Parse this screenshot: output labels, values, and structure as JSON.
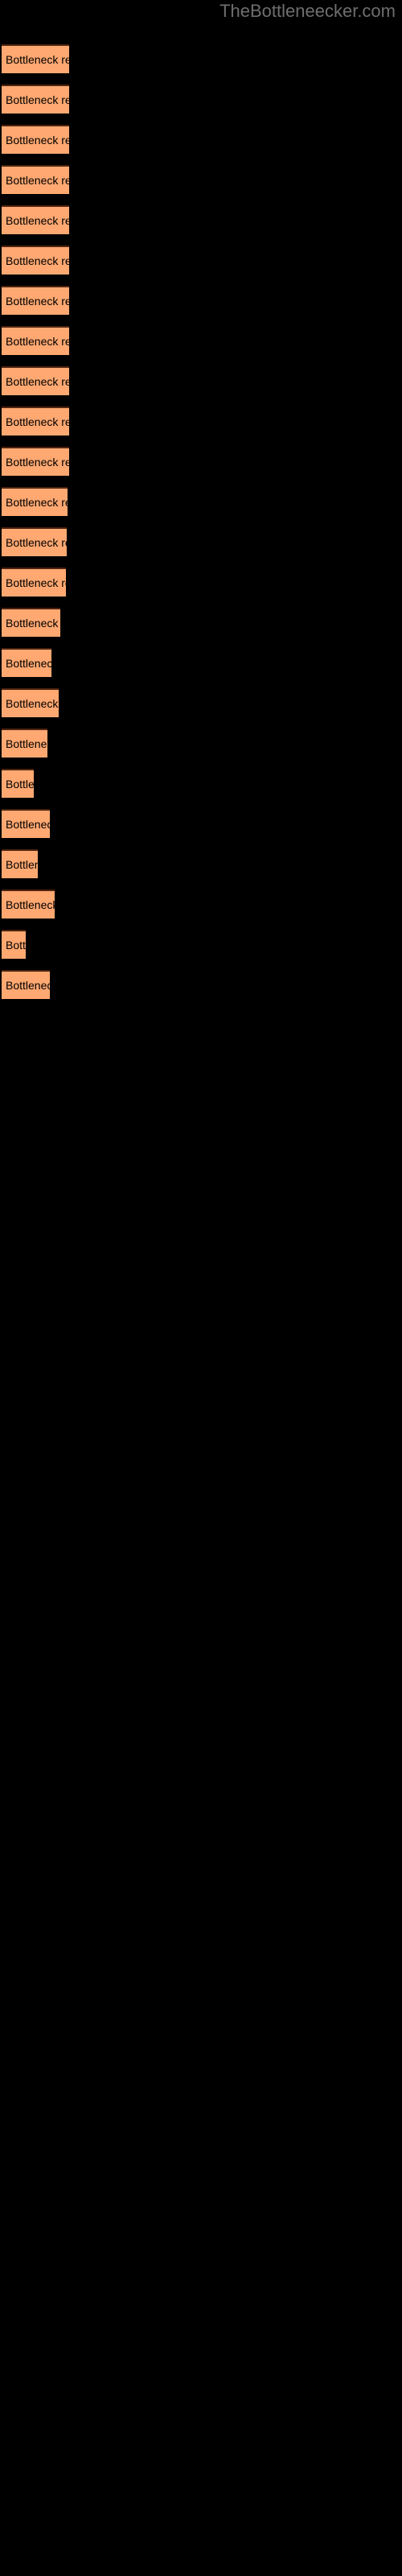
{
  "watermark": {
    "text": "TheBottleneecker.com"
  },
  "chart_data": {
    "type": "bar",
    "orientation": "horizontal",
    "title": "",
    "xlabel": "",
    "ylabel": "",
    "grid": false,
    "legend": null,
    "bar_color": "#ffa871",
    "bar_border_color": "#4d2310",
    "background_color": "#000000",
    "label_color": "#000000",
    "bar_label_text": "Bottleneck result",
    "categories": [
      "Bottleneck result",
      "Bottleneck result",
      "Bottleneck result",
      "Bottleneck result",
      "Bottleneck result",
      "Bottleneck result",
      "Bottleneck result",
      "Bottleneck result",
      "Bottleneck result",
      "Bottleneck result",
      "Bottleneck result",
      "Bottleneck result",
      "Bottleneck result",
      "Bottleneck result",
      "Bottleneck result",
      "Bottleneck result",
      "Bottleneck result",
      "Bottleneck result",
      "Bottleneck result",
      "Bottleneck result",
      "Bottleneck result",
      "Bottleneck result",
      "Bottleneck result",
      "Bottleneck result"
    ],
    "values": [
      84,
      84,
      84,
      84,
      84,
      84,
      84,
      84,
      84,
      84,
      84,
      82,
      81,
      80,
      73,
      62,
      71,
      57,
      40,
      60,
      45,
      66,
      30,
      60
    ],
    "bar_tops": [
      55,
      105,
      155,
      205,
      255,
      305,
      355,
      405,
      455,
      505,
      555,
      605,
      655,
      705,
      755,
      805,
      855,
      905,
      955,
      1005,
      1055,
      1105,
      1155,
      1205
    ],
    "xlim": [
      0,
      84
    ],
    "ylim": null
  }
}
